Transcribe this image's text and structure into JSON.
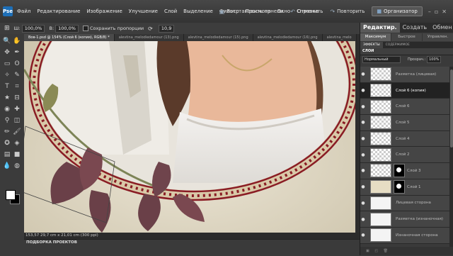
{
  "menubar": {
    "items": [
      "Файл",
      "Редактирование",
      "Изображение",
      "Улучшение",
      "Слой",
      "Выделение",
      "Фильтр",
      "Просмотр",
      "Окно",
      "Справка"
    ],
    "restore_panels": "Восстановить панели",
    "undo": "Отменить",
    "redo": "Повторить",
    "organizer": "Организатор"
  },
  "options": {
    "width_value": "100,0%",
    "height_value": "100,0%",
    "keep_proportions": "Сохранить пропорции",
    "angle_value": "10,9"
  },
  "doc_tabs": [
    "Вов-1.psd @ 154% (Слой 6 (копия), RGB/8) *",
    "alevtina_melodiedamour (13).png",
    "alevtina_melodiedamour (15).png",
    "alevtina_melodiedamour (16).png",
    "alevtina_melo"
  ],
  "status": {
    "text": "153,57  29,7 cm x 21,01 cm (300 ppi)"
  },
  "project_bin": {
    "label": "ПОДБОРКА ПРОЕКТОВ"
  },
  "panel": {
    "modes": [
      "Редактир.",
      "Создать",
      "Обмен"
    ],
    "subtabs": [
      "Максимум",
      "Быстрое",
      "Управлен."
    ],
    "panel_tabs": [
      "ЭФФЕКТЫ",
      "СОДЕРЖИМОЕ"
    ],
    "layers_title": "СЛОИ",
    "blend_mode": "Нормальный",
    "opacity_label": "Прозрач.:",
    "opacity_value": "100%",
    "layers": [
      {
        "name": "Разметка (лицевая)",
        "thumb": "checker",
        "selected": false
      },
      {
        "name": "Слой 6 (копия)",
        "thumb": "checker",
        "selected": true
      },
      {
        "name": "Слой 6",
        "thumb": "checker",
        "selected": false
      },
      {
        "name": "Слой 5",
        "thumb": "checker",
        "selected": false
      },
      {
        "name": "Слой 4",
        "thumb": "checker",
        "selected": false
      },
      {
        "name": "Слой 2",
        "thumb": "checker",
        "selected": false
      },
      {
        "name": "Слой 3",
        "thumb": "checker-mask",
        "selected": false
      },
      {
        "name": "Слой 1",
        "thumb": "cream-mask",
        "selected": false
      },
      {
        "name": "Лицевая сторона",
        "thumb": "solid",
        "selected": false
      },
      {
        "name": "Разметка (изнаночная)",
        "thumb": "solid",
        "selected": false
      },
      {
        "name": "Изнаночная сторона",
        "thumb": "solid",
        "selected": false
      }
    ]
  },
  "colors": {
    "frame": "#8a1c24",
    "leaf": "#6a4048"
  }
}
